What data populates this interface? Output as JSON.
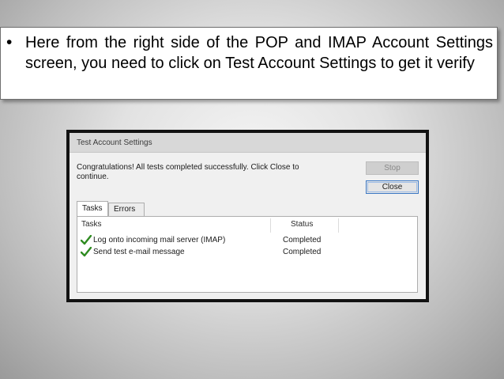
{
  "slide": {
    "bullet_symbol": "•",
    "bullet_text": "Here from the right side of the POP and IMAP Account Settings screen, you need to click on Test Account Settings to get it verify"
  },
  "dialog": {
    "title": "Test Account Settings",
    "message": "Congratulations! All tests completed successfully. Click Close to continue.",
    "stop_label": "Stop",
    "close_label": "Close",
    "tabs": [
      {
        "label": "Tasks",
        "selected": true
      },
      {
        "label": "Errors",
        "selected": false
      }
    ],
    "columns": {
      "tasks": "Tasks",
      "status": "Status"
    },
    "rows": [
      {
        "task": "Log onto incoming mail server (IMAP)",
        "status": "Completed",
        "icon": "check-icon"
      },
      {
        "task": "Send test e-mail message",
        "status": "Completed",
        "icon": "check-icon"
      }
    ],
    "colors": {
      "check": "#2e8b20",
      "close_border": "#3b78c4"
    }
  }
}
